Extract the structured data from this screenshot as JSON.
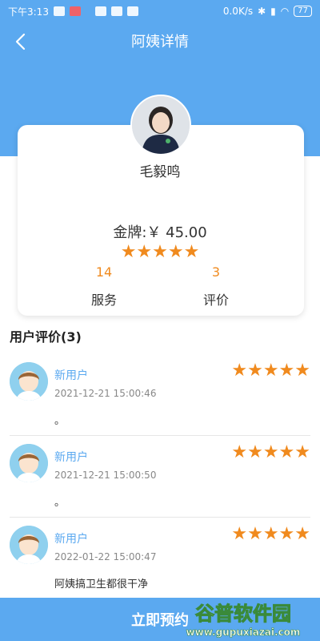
{
  "status_bar": {
    "time": "下午3:13",
    "network": "0.0K/s",
    "battery": "77"
  },
  "nav": {
    "title": "阿姨详情"
  },
  "profile": {
    "name": "毛毅鸣",
    "price": "金牌:￥ 45.00",
    "rating": 5,
    "stars": "★★★★★",
    "stats": [
      {
        "value": "14",
        "label": "服务"
      },
      {
        "value": "3",
        "label": "评价"
      }
    ]
  },
  "reviews": {
    "title": "用户评价(3)",
    "items": [
      {
        "user": "新用户",
        "time": "2021-12-21 15:00:46",
        "stars": "★★★★★",
        "rating": 5,
        "text": "。"
      },
      {
        "user": "新用户",
        "time": "2021-12-21 15:00:50",
        "stars": "★★★★★",
        "rating": 5,
        "text": "。"
      },
      {
        "user": "新用户",
        "time": "2022-01-22 15:00:47",
        "stars": "★★★★★",
        "rating": 5,
        "text": "阿姨搞卫生都很干净"
      }
    ]
  },
  "booking": {
    "label": "立即预约"
  },
  "watermark": {
    "text_cn": "谷普软件园",
    "text_url": "www.gupuxiazai.com"
  },
  "colors": {
    "primary": "#5ba9f0",
    "star": "#f08a1e",
    "card": "#ffffff"
  },
  "icons": [
    "back-arrow-icon",
    "wifi-icon",
    "bluetooth-icon",
    "signal-icon",
    "battery-icon"
  ]
}
